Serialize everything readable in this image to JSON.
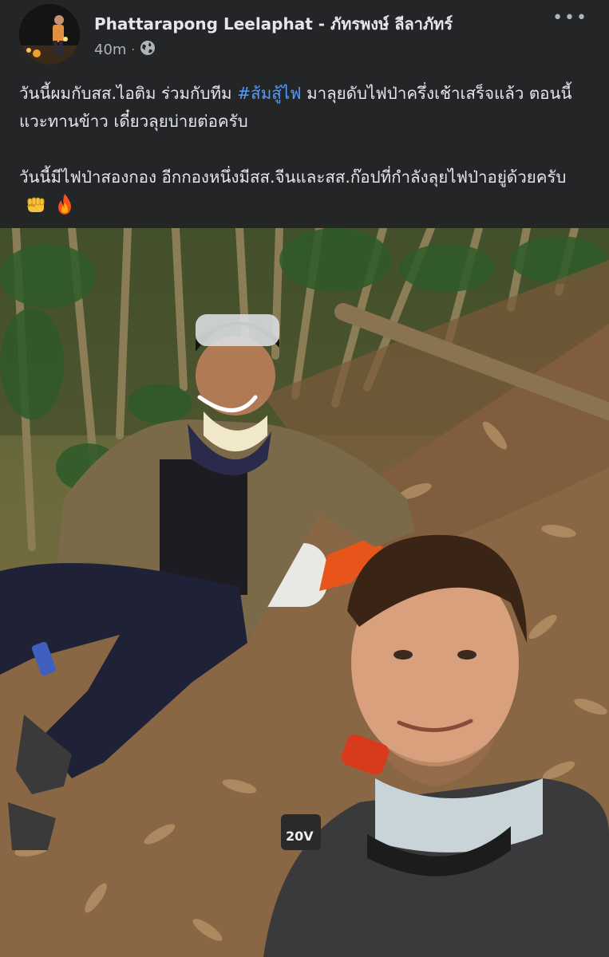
{
  "post": {
    "author_name": "Phattarapong Leelaphat - ภัทรพงษ์ ลีลาภัทร์",
    "timestamp": "40m",
    "privacy_icon": "globe-icon",
    "more_icon": "more-options-icon",
    "paragraph1_before": "วันนี้ผมกับสส.ไอติม ร่วมกับทีม ",
    "hashtag": "#ส้มสู้ไฟ",
    "paragraph1_after": " มาลุยดับไฟป่าครึ่งเช้าเสร็จแล้ว ตอนนี้แวะทานข้าว เดี๋ยวลุยบ่ายต่อครับ",
    "paragraph2": "วันนี้มีไฟป่าสองกอง อีกกองหนึ่งมีสส.จีนและสส.ก๊อปที่กำลังลุยไฟป่าอยู่ด้วยครับ",
    "emojis": [
      "fist-emoji",
      "fire-emoji"
    ],
    "photo_text": "20V"
  },
  "colors": {
    "background": "#242526",
    "text": "#e4e6eb",
    "secondary_text": "#b0b3b8",
    "hashtag": "#4e9cff"
  }
}
